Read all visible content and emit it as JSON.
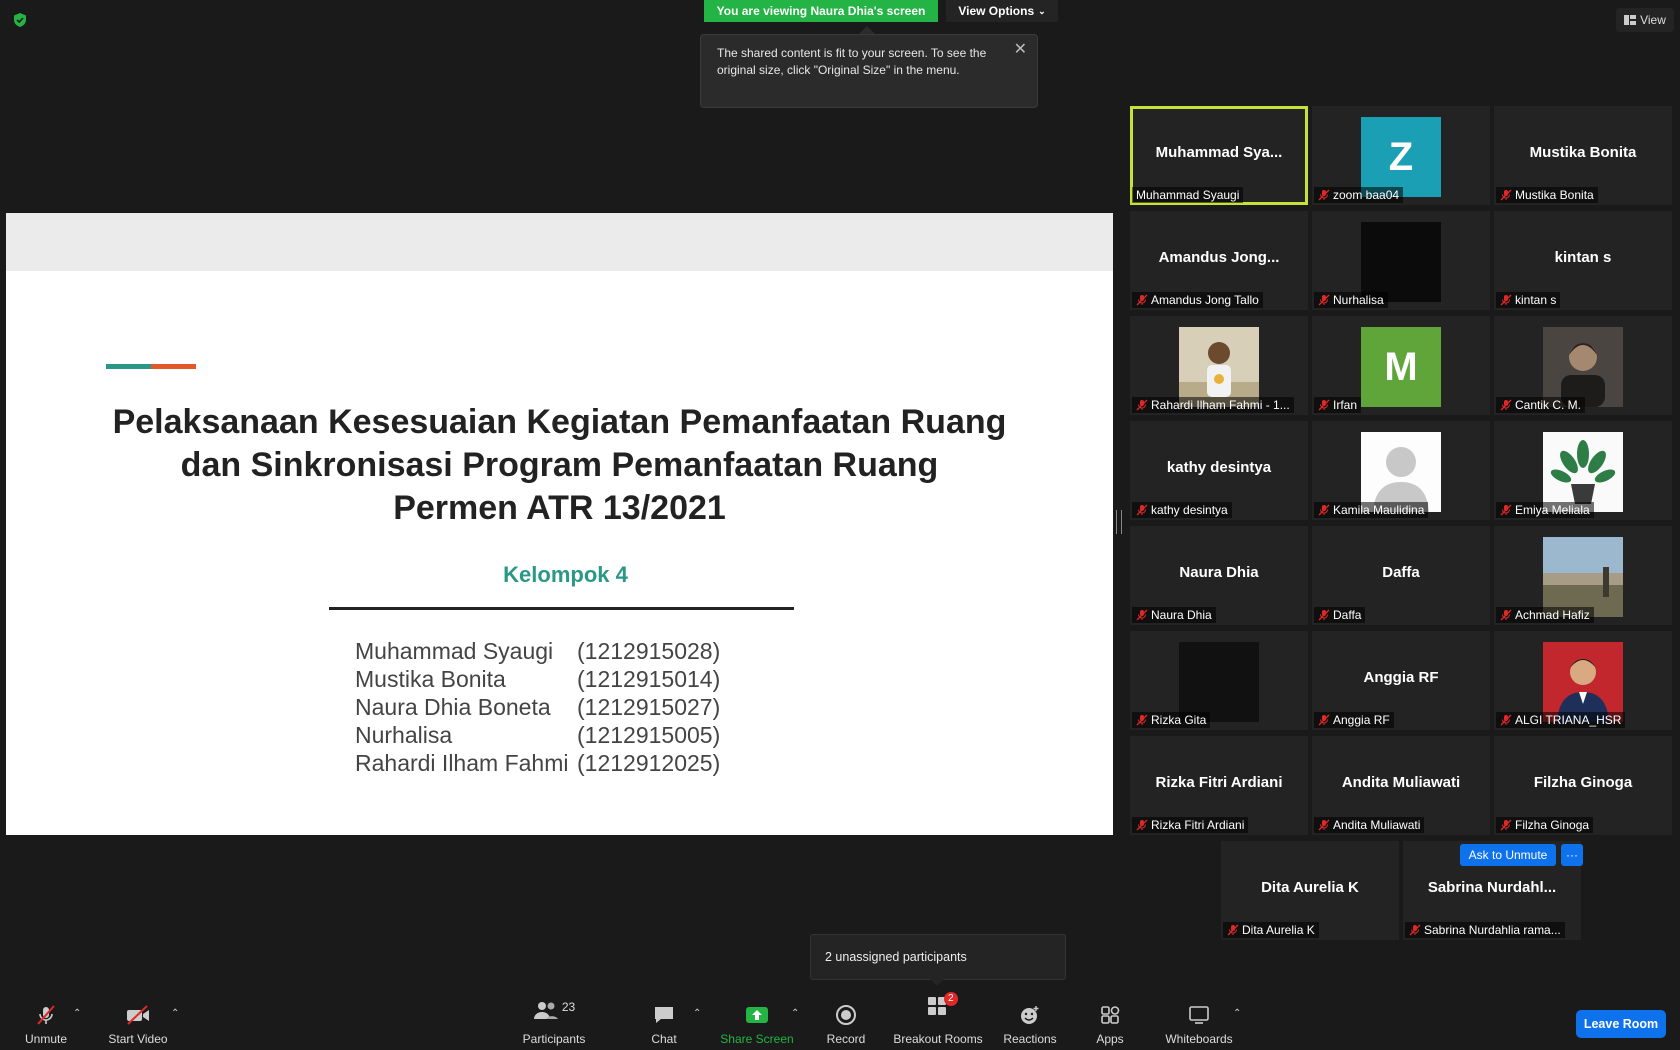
{
  "top_bar": {
    "viewing_banner": "You are viewing Naura Dhia's screen",
    "view_options_label": "View Options",
    "view_label": "View"
  },
  "notice": {
    "text": "The shared content is fit to your screen. To see the original size, click \"Original Size\" in the menu."
  },
  "slide": {
    "title_lines": [
      "Pelaksanaan Kesesuaian Kegiatan Pemanfaatan Ruang",
      "dan Sinkronisasi Program Pemanfaatan Ruang",
      "Permen ATR 13/2021"
    ],
    "subtitle": "Kelompok 4",
    "members": [
      {
        "name": "Muhammad Syaugi",
        "id": "(1212915028)"
      },
      {
        "name": "Mustika Bonita",
        "id": "(1212915014)"
      },
      {
        "name": "Naura Dhia Boneta",
        "id": "(1212915027)"
      },
      {
        "name": "Nurhalisa",
        "id": "(1212915005)"
      },
      {
        "name": "Rahardi Ilham Fahmi",
        "id": "(1212912025)"
      }
    ],
    "accent_colors": [
      "#2a9886",
      "#e3572b"
    ]
  },
  "gallery": [
    {
      "big": "Muhammad  Sya...",
      "label": "Muhammad Syaugi",
      "muted": false,
      "active": true
    },
    {
      "avatar_letter": "Z",
      "avatar_color": "#1b9fb5",
      "label": "zoom baa04",
      "muted": true
    },
    {
      "big": "Mustika Bonita",
      "label": "Mustika Bonita",
      "muted": true
    },
    {
      "big": "Amandus  Jong...",
      "label": "Amandus Jong Tallo",
      "muted": true
    },
    {
      "avatar_color": "#0b0b0b",
      "label": "Nurhalisa",
      "muted": true
    },
    {
      "big": "kintan s",
      "label": "kintan s",
      "muted": true
    },
    {
      "photo": "photo-child",
      "label": "Rahardi Ilham Fahmi - 1...",
      "muted": true
    },
    {
      "avatar_letter": "M",
      "avatar_color": "#5fa53a",
      "label": "Irfan",
      "muted": true
    },
    {
      "photo": "photo-portrait-dark",
      "label": "Cantik C. M.",
      "muted": true
    },
    {
      "big": "kathy desintya",
      "label": "kathy desintya",
      "muted": true
    },
    {
      "photo": "photo-default-person",
      "label": "Kamila Maulidina",
      "muted": true
    },
    {
      "photo": "photo-plant",
      "label": "Emiya Meliala",
      "muted": true
    },
    {
      "big": "Naura Dhia",
      "label": "Naura Dhia",
      "muted": true
    },
    {
      "big": "Daffa",
      "label": "Daffa",
      "muted": true
    },
    {
      "photo": "photo-landscape",
      "label": "Achmad Hafiz",
      "muted": true
    },
    {
      "avatar_color": "#111111",
      "label": "Rizka Gita",
      "muted": true
    },
    {
      "big": "Anggia RF",
      "label": "Anggia RF",
      "muted": true
    },
    {
      "photo": "photo-red-portrait",
      "label": "ALGI TRIANA_HSR",
      "muted": true
    },
    {
      "big": "Rizka Fitri Ardiani",
      "label": "Rizka Fitri Ardiani",
      "muted": true
    },
    {
      "big": "Andita Muliawati",
      "label": "Andita Muliawati",
      "muted": true
    },
    {
      "big": "Filzha Ginoga",
      "label": "Filzha Ginoga",
      "muted": true
    },
    {
      "big": "Dita Aurelia K",
      "label": "Dita Aurelia K",
      "muted": true
    },
    {
      "big": "Sabrina  Nurdahl...",
      "label": "Sabrina Nurdahlia rama...",
      "muted": true
    }
  ],
  "tile_actions": {
    "ask_to_unmute": "Ask to Unmute",
    "more": "···"
  },
  "tooltip": {
    "unassigned": "2 unassigned participants"
  },
  "toolbar": {
    "unmute": "Unmute",
    "start_video": "Start Video",
    "participants": "Participants",
    "participants_count": "23",
    "chat": "Chat",
    "share_screen": "Share Screen",
    "record": "Record",
    "breakout_rooms": "Breakout Rooms",
    "breakout_badge": "2",
    "reactions": "Reactions",
    "apps": "Apps",
    "whiteboards": "Whiteboards",
    "leave_room": "Leave Room"
  },
  "colors": {
    "active_speaker": "#c6e23a",
    "share_green": "#23b445",
    "accent_blue": "#0e72ed",
    "muted_red": "#e02828"
  }
}
